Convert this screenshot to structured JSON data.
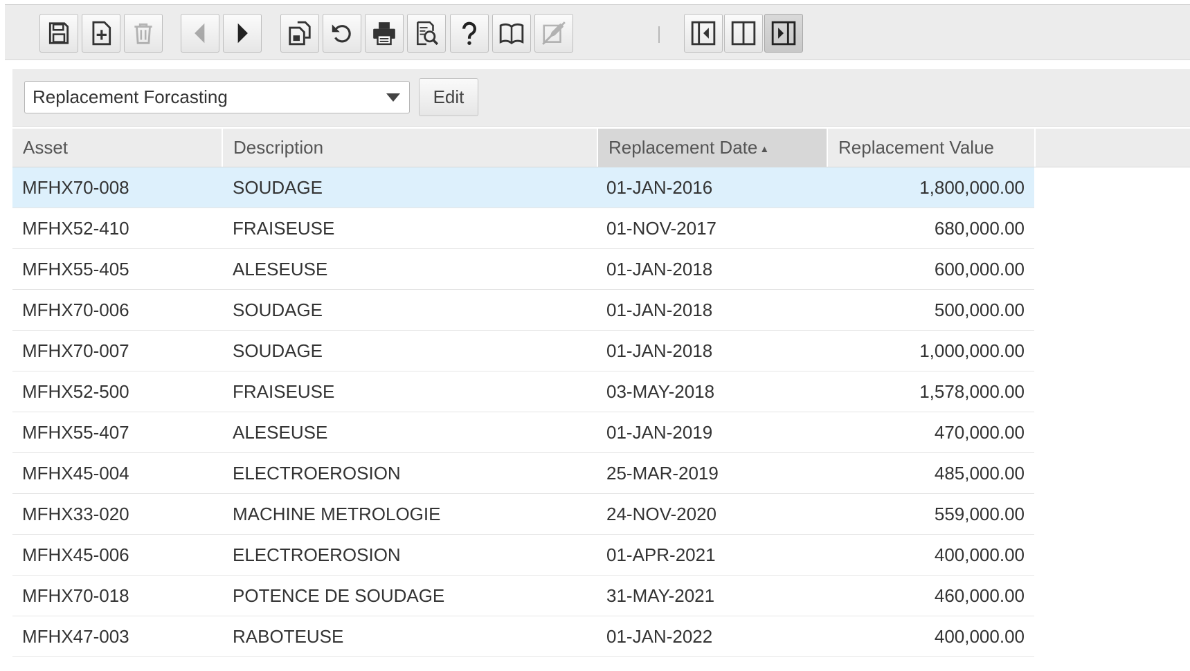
{
  "toolbar": {
    "buttons": [
      {
        "id": "save",
        "icon": "save-icon"
      },
      {
        "id": "new",
        "icon": "new-record-icon"
      },
      {
        "id": "delete",
        "icon": "trash-icon"
      },
      {
        "id": "previous",
        "icon": "previous-arrow-icon"
      },
      {
        "id": "next",
        "icon": "next-arrow-icon"
      },
      {
        "id": "copy",
        "icon": "copy-record-icon"
      },
      {
        "id": "refresh",
        "icon": "refresh-icon"
      },
      {
        "id": "print",
        "icon": "printer-icon"
      },
      {
        "id": "print-preview",
        "icon": "print-preview-icon"
      },
      {
        "id": "help",
        "icon": "question-mark-icon"
      },
      {
        "id": "book",
        "icon": "book-icon"
      },
      {
        "id": "edit-disabled",
        "icon": "no-edit-icon"
      },
      {
        "id": "layout-left",
        "icon": "layout-left-panel-icon"
      },
      {
        "id": "layout-split",
        "icon": "layout-split-icon"
      },
      {
        "id": "layout-right",
        "icon": "layout-right-panel-icon"
      }
    ]
  },
  "filter": {
    "selected": "Replacement Forcasting",
    "edit_label": "Edit"
  },
  "grid": {
    "columns": {
      "asset": "Asset",
      "description": "Description",
      "replacement_date": "Replacement Date",
      "replacement_value": "Replacement Value"
    },
    "sort_indicator": "▲",
    "rows": [
      {
        "asset": "MFHX70-008",
        "description": "SOUDAGE",
        "date": "01-JAN-2016",
        "value": "1,800,000.00"
      },
      {
        "asset": "MFHX52-410",
        "description": "FRAISEUSE",
        "date": "01-NOV-2017",
        "value": "680,000.00"
      },
      {
        "asset": "MFHX55-405",
        "description": "ALESEUSE",
        "date": "01-JAN-2018",
        "value": "600,000.00"
      },
      {
        "asset": "MFHX70-006",
        "description": "SOUDAGE",
        "date": "01-JAN-2018",
        "value": "500,000.00"
      },
      {
        "asset": "MFHX70-007",
        "description": "SOUDAGE",
        "date": "01-JAN-2018",
        "value": "1,000,000.00"
      },
      {
        "asset": "MFHX52-500",
        "description": "FRAISEUSE",
        "date": "03-MAY-2018",
        "value": "1,578,000.00"
      },
      {
        "asset": "MFHX55-407",
        "description": "ALESEUSE",
        "date": "01-JAN-2019",
        "value": "470,000.00"
      },
      {
        "asset": "MFHX45-004",
        "description": "ELECTROEROSION",
        "date": "25-MAR-2019",
        "value": "485,000.00"
      },
      {
        "asset": "MFHX33-020",
        "description": "MACHINE METROLOGIE",
        "date": "24-NOV-2020",
        "value": "559,000.00"
      },
      {
        "asset": "MFHX45-006",
        "description": "ELECTROEROSION",
        "date": "01-APR-2021",
        "value": "400,000.00"
      },
      {
        "asset": "MFHX70-018",
        "description": "POTENCE DE SOUDAGE",
        "date": "31-MAY-2021",
        "value": "460,000.00"
      },
      {
        "asset": "MFHX47-003",
        "description": "RABOTEUSE",
        "date": "01-JAN-2022",
        "value": "400,000.00"
      }
    ]
  }
}
